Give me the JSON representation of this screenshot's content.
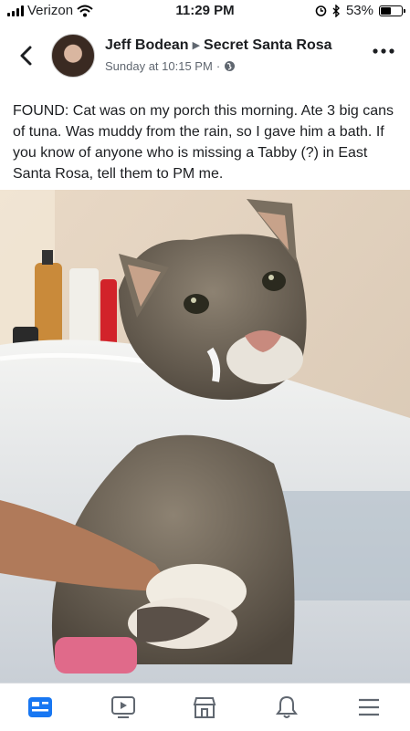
{
  "status": {
    "carrier": "Verizon",
    "time": "11:29 PM",
    "battery": "53%",
    "battery_level": 0.53
  },
  "post": {
    "author": "Jeff Bodean",
    "group": "Secret Santa Rosa",
    "timestamp": "Sunday at 10:15 PM",
    "audience_icon": "globe-icon",
    "text": "FOUND: Cat was on my porch this morning. Ate 3 big cans of tuna. Was muddy from the rain, so I gave him a bath. If you know of anyone who is missing a Tabby (?) in East Santa Rosa, tell them to PM me."
  },
  "nav": {
    "items": [
      "news-feed-icon",
      "watch-icon",
      "marketplace-icon",
      "notifications-icon",
      "menu-icon"
    ],
    "active": "news-feed-icon",
    "active_color": "#1877f2",
    "inactive_color": "#606770"
  }
}
